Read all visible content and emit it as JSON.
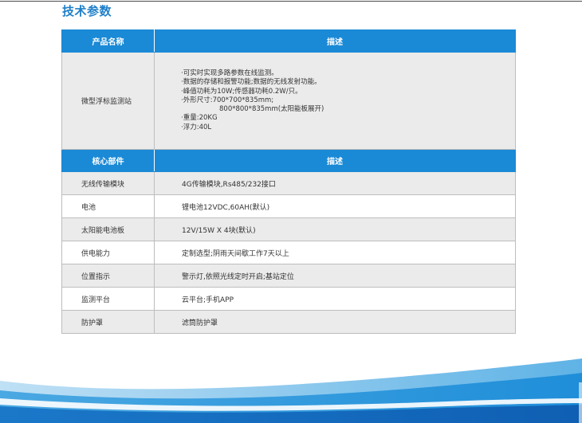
{
  "page": {
    "title": "技术参数"
  },
  "table1": {
    "headers": {
      "name": "产品名称",
      "desc": "描述"
    },
    "product": {
      "name": "微型浮标监测站",
      "lines": [
        "·可实时实现多路参数在线监测。",
        "·数据的存储和报警功能;数据的无线发射功能。",
        "·峰值功耗为10W;传感器功耗0.2W/只。",
        "·外形尺寸:700*700*835mm;",
        "800*800*835mm(太阳能板展开)",
        "·重量:20KG",
        "·浮力:40L"
      ]
    }
  },
  "table2": {
    "headers": {
      "name": "核心部件",
      "desc": "描述"
    },
    "rows": [
      {
        "name": "无线传输模块",
        "desc": "4G传输模块,Rs485/232接口"
      },
      {
        "name": "电池",
        "desc": "锂电池12VDC,60AH(默认)"
      },
      {
        "name": "太阳能电池板",
        "desc": "12V/15W X 4块(默认)"
      },
      {
        "name": "供电能力",
        "desc": "定制选型;阴雨天间歇工作7天以上"
      },
      {
        "name": "位置指示",
        "desc": "警示灯,依照光线定时开启;基站定位"
      },
      {
        "name": "监测平台",
        "desc": "云平台;手机APP"
      },
      {
        "name": "防护罩",
        "desc": "滤筒防护罩"
      }
    ]
  },
  "colors": {
    "accent": "#1b8ad6",
    "title": "#1f7fc8",
    "row_gray": "#ebebeb"
  }
}
